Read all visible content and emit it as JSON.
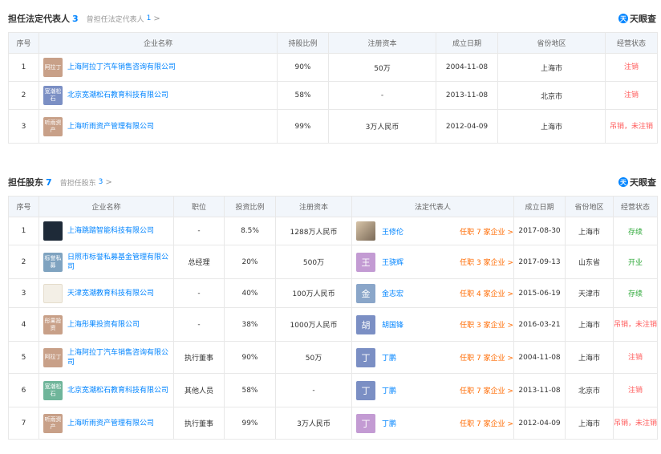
{
  "section1": {
    "title": "担任法定代表人",
    "count": "3",
    "sub_label": "曾担任法定代表人",
    "sub_count": "1",
    "chevron": ">"
  },
  "section2": {
    "title": "担任股东",
    "count": "7",
    "sub_label": "曾担任股东",
    "sub_count": "3",
    "chevron": ">"
  },
  "brand": {
    "mark": "天",
    "text": "天眼查",
    "color": "#0084ff"
  },
  "table1": {
    "headers": [
      "序号",
      "企业名称",
      "持股比例",
      "注册资本",
      "成立日期",
      "省份地区",
      "经营状态"
    ],
    "rows": [
      {
        "no": "1",
        "logo": "阿拉丁",
        "logo_color": "#c8a088",
        "company": "上海阿拉丁汽车销售咨询有限公司",
        "ratio": "90%",
        "capital": "50万",
        "date": "2004-11-08",
        "region": "上海市",
        "status": "注销"
      },
      {
        "no": "2",
        "logo": "宽潮松石",
        "logo_color": "#7b8fc4",
        "company": "北京宽潮松石教育科技有限公司",
        "ratio": "58%",
        "capital": "-",
        "date": "2013-11-08",
        "region": "北京市",
        "status": "注销"
      },
      {
        "no": "3",
        "logo": "听雨资产",
        "logo_color": "#c8a088",
        "company": "上海听雨资产管理有限公司",
        "ratio": "99%",
        "capital": "3万人民币",
        "date": "2012-04-09",
        "region": "上海市",
        "status": "吊销，未注销"
      }
    ]
  },
  "table2": {
    "headers": [
      "序号",
      "企业名称",
      "职位",
      "投资比例",
      "注册资本",
      "法定代表人",
      "成立日期",
      "省份地区",
      "经营状态"
    ],
    "rows": [
      {
        "no": "1",
        "logo": "",
        "logo_style": "dark",
        "company": "上海跳踏智能科技有限公司",
        "position": "-",
        "ratio": "8.5%",
        "capital": "1288万人民币",
        "rep_avatar": "",
        "rep_avatar_style": "photo",
        "rep": "王修伦",
        "role": "任职 7 家企业 >",
        "date": "2017-08-30",
        "region": "上海市",
        "status": "存续",
        "status_type": "active"
      },
      {
        "no": "2",
        "logo": "标誉私募",
        "logo_color": "#7fa3c0",
        "company": "日照市标誉私募基金管理有限公司",
        "position": "总经理",
        "ratio": "20%",
        "capital": "500万",
        "rep_avatar": "王",
        "rep_avatar_color": "#c39bd3",
        "rep": "王骁辉",
        "role": "任职 3 家企业 >",
        "date": "2017-09-13",
        "region": "山东省",
        "status": "开业",
        "status_type": "active"
      },
      {
        "no": "3",
        "logo": "",
        "logo_style": "light",
        "company": "天津宽潮教育科技有限公司",
        "position": "-",
        "ratio": "40%",
        "capital": "100万人民币",
        "rep_avatar": "金",
        "rep_avatar_color": "#8aa6c9",
        "rep": "金志宏",
        "role": "任职 4 家企业 >",
        "date": "2015-06-19",
        "region": "天津市",
        "status": "存续",
        "status_type": "active"
      },
      {
        "no": "4",
        "logo": "彤果投资",
        "logo_color": "#c8a088",
        "company": "上海彤果投资有限公司",
        "position": "-",
        "ratio": "38%",
        "capital": "1000万人民币",
        "rep_avatar": "胡",
        "rep_avatar_color": "#7b8fc4",
        "rep": "胡国锋",
        "role": "任职 3 家企业 >",
        "date": "2016-03-21",
        "region": "上海市",
        "status": "吊销，未注销",
        "status_type": "cancel"
      },
      {
        "no": "5",
        "logo": "阿拉丁",
        "logo_color": "#c8a088",
        "company": "上海阿拉丁汽车销售咨询有限公司",
        "position": "执行董事",
        "ratio": "90%",
        "capital": "50万",
        "rep_avatar": "丁",
        "rep_avatar_color": "#7b8fc4",
        "rep": "丁鹏",
        "role": "任职 7 家企业 >",
        "date": "2004-11-08",
        "region": "上海市",
        "status": "注销",
        "status_type": "cancel"
      },
      {
        "no": "6",
        "logo": "宽潮松石",
        "logo_color": "#6fb59a",
        "company": "北京宽潮松石教育科技有限公司",
        "position": "其他人员",
        "ratio": "58%",
        "capital": "-",
        "rep_avatar": "丁",
        "rep_avatar_color": "#7b8fc4",
        "rep": "丁鹏",
        "role": "任职 7 家企业 >",
        "date": "2013-11-08",
        "region": "北京市",
        "status": "注销",
        "status_type": "cancel"
      },
      {
        "no": "7",
        "logo": "听雨资产",
        "logo_color": "#c8a088",
        "company": "上海听雨资产管理有限公司",
        "position": "执行董事",
        "ratio": "99%",
        "capital": "3万人民币",
        "rep_avatar": "丁",
        "rep_avatar_color": "#c39bd3",
        "rep": "丁鹏",
        "role": "任职 7 家企业 >",
        "date": "2012-04-09",
        "region": "上海市",
        "status": "吊销，未注销",
        "status_type": "cancel"
      }
    ]
  }
}
